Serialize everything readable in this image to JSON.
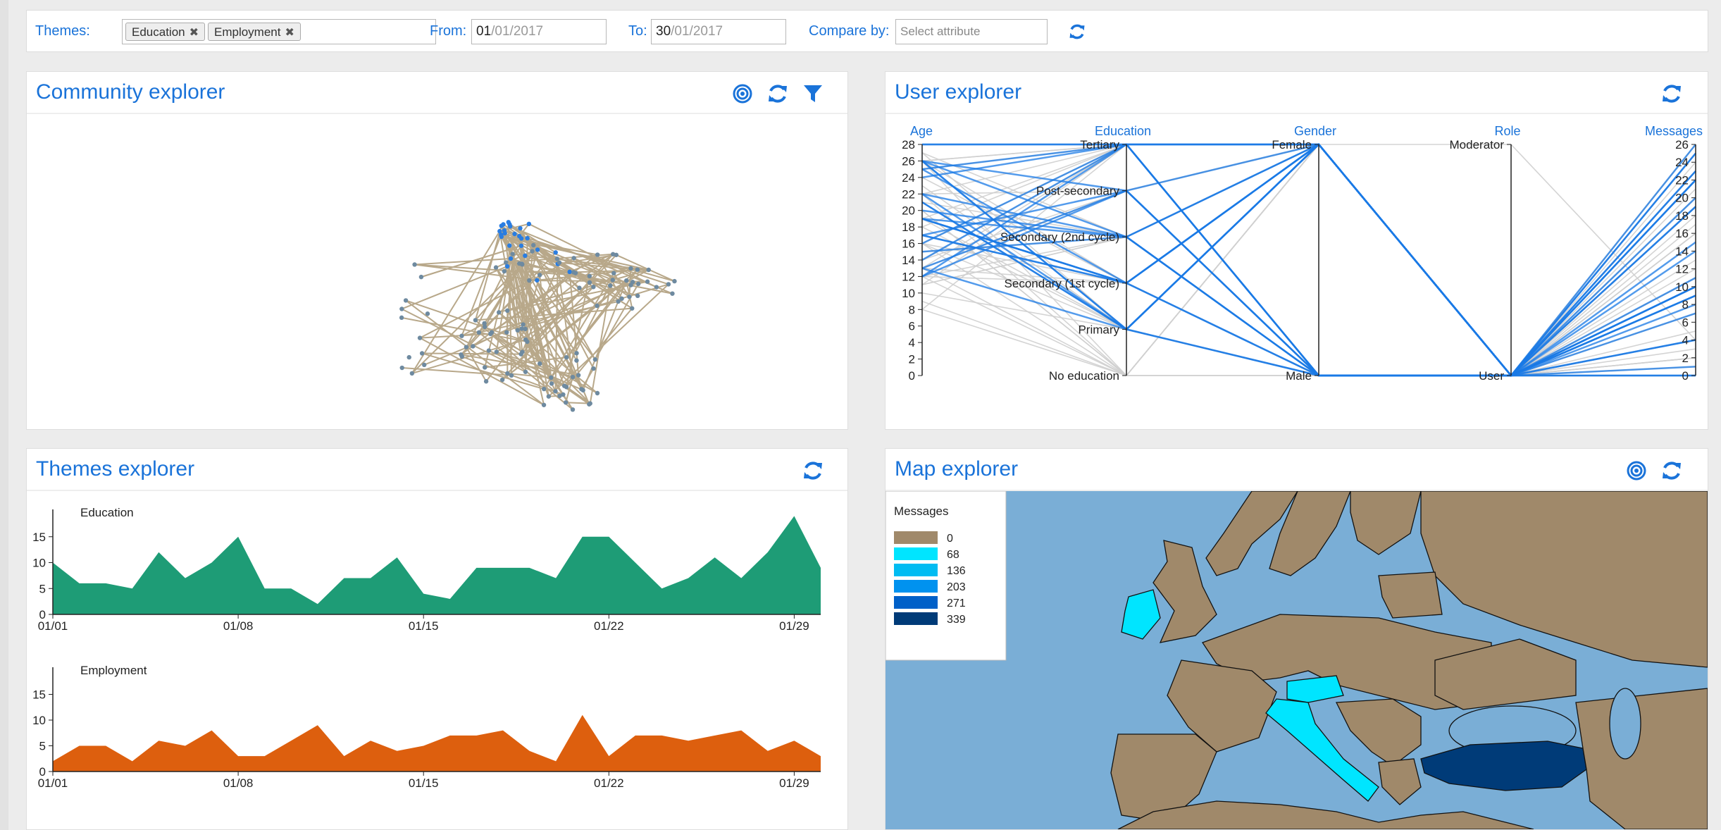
{
  "filters": {
    "themes_label": "Themes:",
    "themes": [
      "Education",
      "Employment"
    ],
    "from_label": "From:",
    "from_value_day": "01",
    "from_value_rest": "/01/2017",
    "to_label": "To:",
    "to_value_day": "30",
    "to_value_rest": "/01/2017",
    "compare_label": "Compare by:",
    "compare_placeholder": "Select attribute"
  },
  "panels": {
    "community": {
      "title": "Community explorer"
    },
    "user": {
      "title": "User explorer"
    },
    "themes": {
      "title": "Themes explorer"
    },
    "map": {
      "title": "Map explorer"
    }
  },
  "colors": {
    "accent": "#1a73d9",
    "network_edge": "#b8a88a",
    "network_node": "#6e8aa0",
    "network_node_highlight": "#2a7de1",
    "education_area": "#1e9c76",
    "employment_area": "#dd5f0e",
    "sea": "#7aaed6",
    "land": "#a0896a",
    "map_scale": [
      "#a0896a",
      "#00e5ff",
      "#00bcf2",
      "#0092ef",
      "#0060c8",
      "#003b78"
    ]
  },
  "user_explorer": {
    "axes": [
      "Age",
      "Education",
      "Gender",
      "Role",
      "Messages"
    ],
    "age_ticks": [
      "28",
      "26",
      "24",
      "22",
      "20",
      "18",
      "16",
      "14",
      "12",
      "10",
      "8",
      "6",
      "4",
      "2",
      "0"
    ],
    "education_levels": [
      "Tertiary",
      "Post-secondary",
      "Secondary (2nd cycle)",
      "Secondary (1st cycle)",
      "Primary",
      "No education"
    ],
    "genders": [
      "Female",
      "Male"
    ],
    "roles": [
      "Moderator",
      "User"
    ],
    "message_ticks": [
      "26",
      "24",
      "22",
      "20",
      "18",
      "16",
      "14",
      "12",
      "10",
      "8",
      "6",
      "4",
      "2",
      "0"
    ]
  },
  "map_explorer": {
    "legend_title": "Messages",
    "legend_values": [
      "0",
      "68",
      "136",
      "203",
      "271",
      "339"
    ]
  },
  "chart_data": [
    {
      "type": "area",
      "title": "Education",
      "x": [
        "01/01",
        "01/02",
        "01/03",
        "01/04",
        "01/05",
        "01/06",
        "01/07",
        "01/08",
        "01/09",
        "01/10",
        "01/11",
        "01/12",
        "01/13",
        "01/14",
        "01/15",
        "01/16",
        "01/17",
        "01/18",
        "01/19",
        "01/20",
        "01/21",
        "01/22",
        "01/23",
        "01/24",
        "01/25",
        "01/26",
        "01/27",
        "01/28",
        "01/29",
        "01/30"
      ],
      "x_tick_labels": [
        "01/01",
        "01/08",
        "01/15",
        "01/22",
        "01/29"
      ],
      "values": [
        10,
        6,
        6,
        5,
        12,
        7,
        10,
        15,
        5,
        5,
        2,
        7,
        7,
        11,
        4,
        3,
        9,
        9,
        9,
        7,
        15,
        15,
        10,
        5,
        7,
        11,
        7,
        12,
        19,
        9
      ],
      "ylim": [
        0,
        20
      ],
      "y_ticks": [
        "0",
        "5",
        "10",
        "15"
      ]
    },
    {
      "type": "area",
      "title": "Employment",
      "x": [
        "01/01",
        "01/02",
        "01/03",
        "01/04",
        "01/05",
        "01/06",
        "01/07",
        "01/08",
        "01/09",
        "01/10",
        "01/11",
        "01/12",
        "01/13",
        "01/14",
        "01/15",
        "01/16",
        "01/17",
        "01/18",
        "01/19",
        "01/20",
        "01/21",
        "01/22",
        "01/23",
        "01/24",
        "01/25",
        "01/26",
        "01/27",
        "01/28",
        "01/29",
        "01/30"
      ],
      "x_tick_labels": [
        "01/01",
        "01/08",
        "01/15",
        "01/22",
        "01/29"
      ],
      "values": [
        2,
        5,
        5,
        2,
        6,
        5,
        8,
        3,
        3,
        6,
        9,
        3,
        6,
        4,
        5,
        7,
        7,
        8,
        4,
        2,
        11,
        3,
        7,
        7,
        6,
        7,
        8,
        4,
        6,
        3
      ],
      "ylim": [
        0,
        20
      ],
      "y_ticks": [
        "0",
        "5",
        "10",
        "15"
      ]
    }
  ]
}
